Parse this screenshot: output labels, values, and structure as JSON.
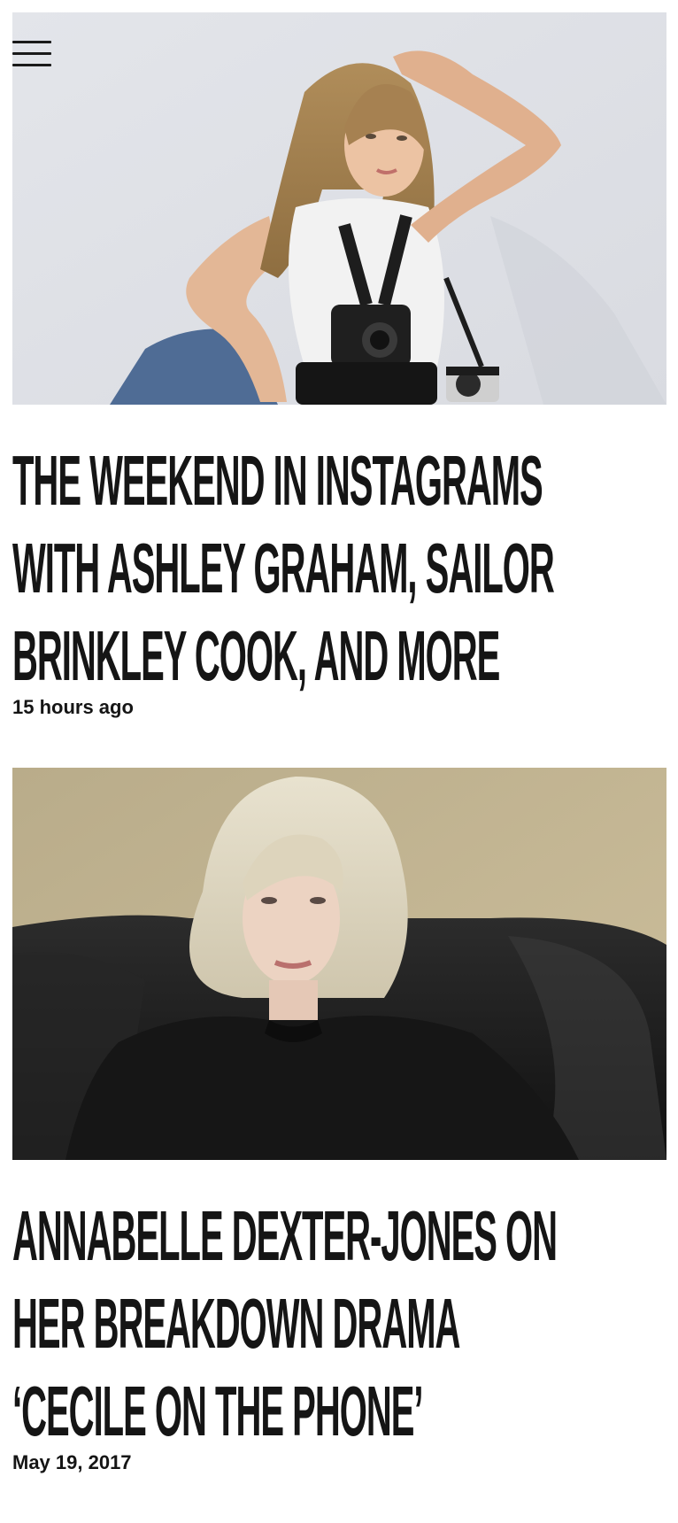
{
  "articles": [
    {
      "title": "The Weekend in Instagrams With Ashley Graham, Sailor Brinkley Cook, and More",
      "date": "15 hours ago",
      "image_label": "Woman with long blonde hair holding cameras, seated against a white backdrop"
    },
    {
      "title": "Annabelle Dexter-Jones on Her Breakdown Drama ‘Cecile on the Phone’",
      "date": "May 19, 2017",
      "image_label": "Woman with short platinum blonde hair in a black top seated on a black leather chair"
    }
  ],
  "menu": {
    "icon": "hamburger-menu-icon"
  },
  "colors": {
    "text": "#151515",
    "background": "#ffffff"
  }
}
